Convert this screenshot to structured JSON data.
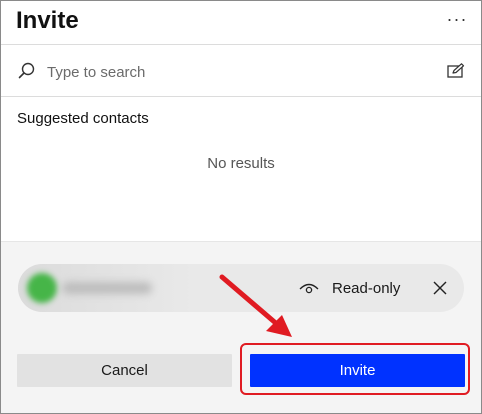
{
  "header": {
    "title": "Invite",
    "more_icon": "more-options-icon",
    "more_label": "···"
  },
  "search": {
    "placeholder": "Type to search",
    "value": "",
    "icon": "search-icon",
    "action_icon": "edit-icon"
  },
  "contacts": {
    "heading": "Suggested contacts",
    "empty_text": "No results"
  },
  "recipient": {
    "permission_label": "Read-only",
    "permission_icon": "eye-icon",
    "remove_icon": "close-icon",
    "avatar_color": "#46b548"
  },
  "actions": {
    "cancel_label": "Cancel",
    "invite_label": "Invite"
  },
  "colors": {
    "invite_button": "#0032ff",
    "annotation": "#e01b22"
  }
}
